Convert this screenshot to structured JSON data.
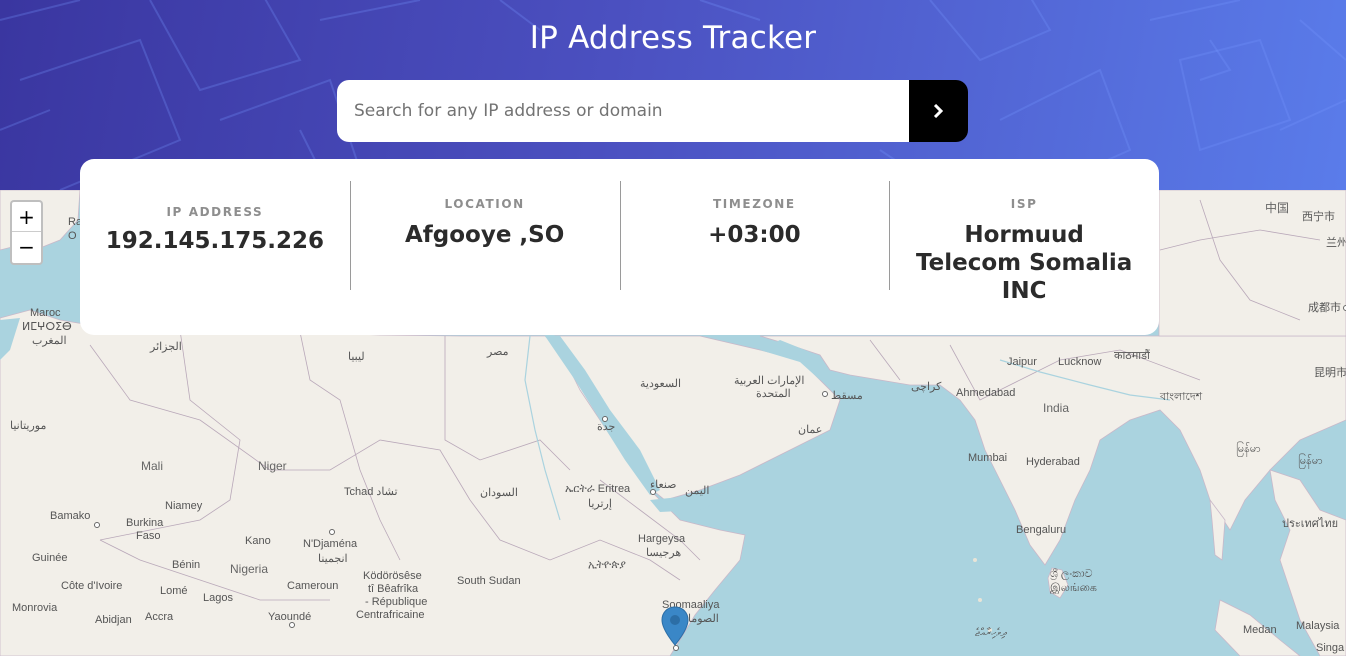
{
  "header": {
    "title": "IP Address Tracker",
    "search": {
      "placeholder": "Search for any IP address or domain",
      "value": "",
      "button_icon": "chevron-right-icon"
    }
  },
  "info": {
    "ip": {
      "label": "IP ADDRESS",
      "value": "192.145.175.226"
    },
    "location": {
      "label": "LOCATION",
      "value": "Afgooye ,SO"
    },
    "timezone": {
      "label": "TIMEZONE",
      "value": "+03:00"
    },
    "isp": {
      "label": "ISP",
      "value": "Hormuud Telecom Somalia INC"
    }
  },
  "map": {
    "zoom_in": "+",
    "zoom_out": "−",
    "marker_icon": "map-pin-icon",
    "labels": {
      "maroc": "Maroc",
      "maroc_tf": "ⵍⵎⵖⵔⵉⴱ",
      "maroc_ar": "المغرب",
      "aljazair": "الجزائر",
      "libya": "ليبيا",
      "misr": "مصر",
      "saudi": "السعودية",
      "uae": "الإمارات العربية",
      "uae2": "المتحدة",
      "muscat": "مسقط",
      "oman": "عمان",
      "jeddah": "جدة",
      "karachi": "کراچی",
      "jaipur": "Jaipur",
      "lucknow": "Lucknow",
      "kathmandu": "काठमाडौं",
      "ahmedabad": "Ahmedabad",
      "india": "India",
      "mumbai": "Mumbai",
      "hyderabad": "Hyderabad",
      "bengaluru": "Bengaluru",
      "srilanka_si": "ශ්‍රී ලංකාව",
      "srilanka_ta": "இலங்கை",
      "maldives": "ދިވެހިރާއްޖެ",
      "bangladesh": "বাংলাদেশ",
      "myanmar": "မြန်မာ",
      "thailand": "ประเทศไทย",
      "medan": "Medan",
      "malaysia": "Malaysia",
      "singapore": "Singa",
      "china": "中国",
      "xining": "西宁市",
      "lanzhou": "兰州",
      "chengdu": "成都市",
      "kunming": "昆明市",
      "mauritania": "موريتانيا",
      "mali": "Mali",
      "niger": "Niger",
      "tchad": "Tchad تشاد",
      "sudan": "السودان",
      "eritrea": "ኤርትራ Eritrea",
      "eritrea_ar": "إرتريا",
      "sanaa": "صنعاء",
      "yemen": "اليمن",
      "bamako": "Bamako",
      "niamey": "Niamey",
      "burkina": "Burkina",
      "faso": "Faso",
      "ndjamena": "N'Djaména",
      "ndjamena_ar": "انجمينا",
      "kano": "Kano",
      "hargeysa": "Hargeysa",
      "hargeysa_ar": "هرجيسا",
      "ethiopia": "ኢትዮጵያ",
      "guinee": "Guinée",
      "benin": "Bénin",
      "nigeria": "Nigeria",
      "cameroun": "Cameroun",
      "car1": "Ködörösêse",
      "car2": "tî Bêafrîka",
      "car3": "- République",
      "car4": "Centrafricaine",
      "south_sudan": "South Sudan",
      "cote": "Côte d'Ivoire",
      "lome": "Lomé",
      "lagos": "Lagos",
      "monrovia": "Monrovia",
      "abidjan": "Abidjan",
      "accra": "Accra",
      "yaounde": "Yaoundé",
      "soomaaliya": "Soomaaliya",
      "somalia_ar": "الصومال",
      "rabat": "Ra",
      "o": "O"
    }
  }
}
